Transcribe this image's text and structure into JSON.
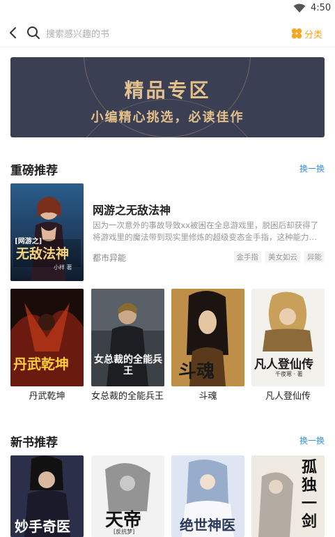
{
  "status_bar": {
    "time": "4:50"
  },
  "search": {
    "placeholder": "搜索感兴趣的书",
    "category_label": "分类"
  },
  "banner": {
    "title": "精品专区",
    "subtitle": "小编精心挑选，必读佳作"
  },
  "section_featured": {
    "title": "重磅推荐",
    "more_label": "换一换"
  },
  "featured_book": {
    "title": "网游之无敌法神",
    "description": "因为一次意外的事故导致xx被困在全息游戏里，脱困后却获得了将游戏里的魔法带到现实里修炼的超级变态金手指，这种能力…",
    "genre": "都市异能",
    "tags": [
      "金手指",
      "美女如云",
      "异能"
    ],
    "cover_title": "无敌法神",
    "cover_badge": "[网游之]",
    "cover_author": "小样 著"
  },
  "featured_grid": [
    {
      "title": "丹武乾坤",
      "cover_text": "丹武乾坤"
    },
    {
      "title": "女总裁的全能兵王",
      "cover_text": "女总裁的全能兵王"
    },
    {
      "title": "斗魂",
      "cover_text": "斗魂"
    },
    {
      "title": "凡人登仙传",
      "cover_text": "凡人登仙传",
      "cover_sub": "千夜寒 · 著"
    }
  ],
  "section_new": {
    "title": "新书推荐",
    "more_label": "换一换"
  },
  "new_grid": [
    {
      "cover_text": "妙手奇医"
    },
    {
      "cover_text": "天帝",
      "cover_sub": "[反抗梦]"
    },
    {
      "cover_text": "绝世神医"
    },
    {
      "cover_text": "孤独一剑"
    }
  ],
  "colors": {
    "accent_orange": "#f5a623",
    "link_blue": "#3a8ee6",
    "banner_bg": "#3b3f53",
    "banner_gold": "#e3c08c"
  }
}
